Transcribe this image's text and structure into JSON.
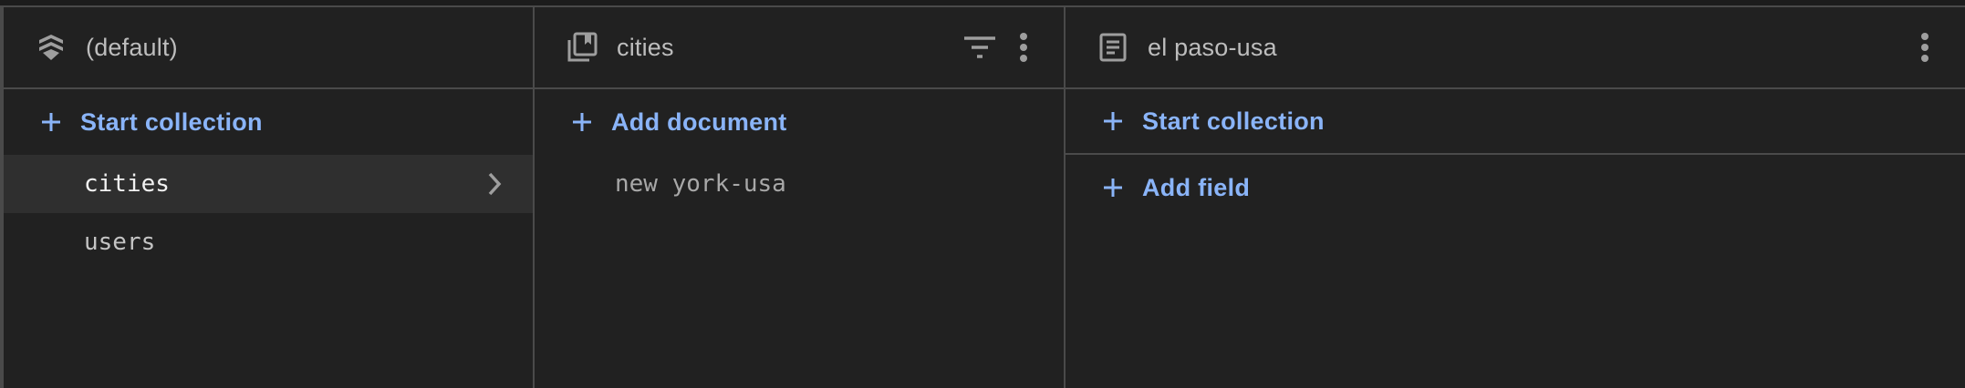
{
  "panels": [
    {
      "title": "(default)",
      "icon": "firestore-stack-icon",
      "action_label": "Start collection",
      "items": [
        {
          "label": "cities",
          "selected": true
        },
        {
          "label": "users",
          "selected": false
        }
      ]
    },
    {
      "title": "cities",
      "icon": "collection-icon",
      "action_label": "Add document",
      "items": [
        {
          "label": "new york-usa"
        }
      ]
    },
    {
      "title": "el paso-usa",
      "icon": "document-icon",
      "actions": [
        {
          "label": "Start collection"
        },
        {
          "label": "Add field"
        }
      ]
    }
  ],
  "colors": {
    "background": "#212121",
    "accent": "#8ab4f8",
    "divider": "#4a4a4a",
    "selected_row": "#2f2f2f"
  }
}
